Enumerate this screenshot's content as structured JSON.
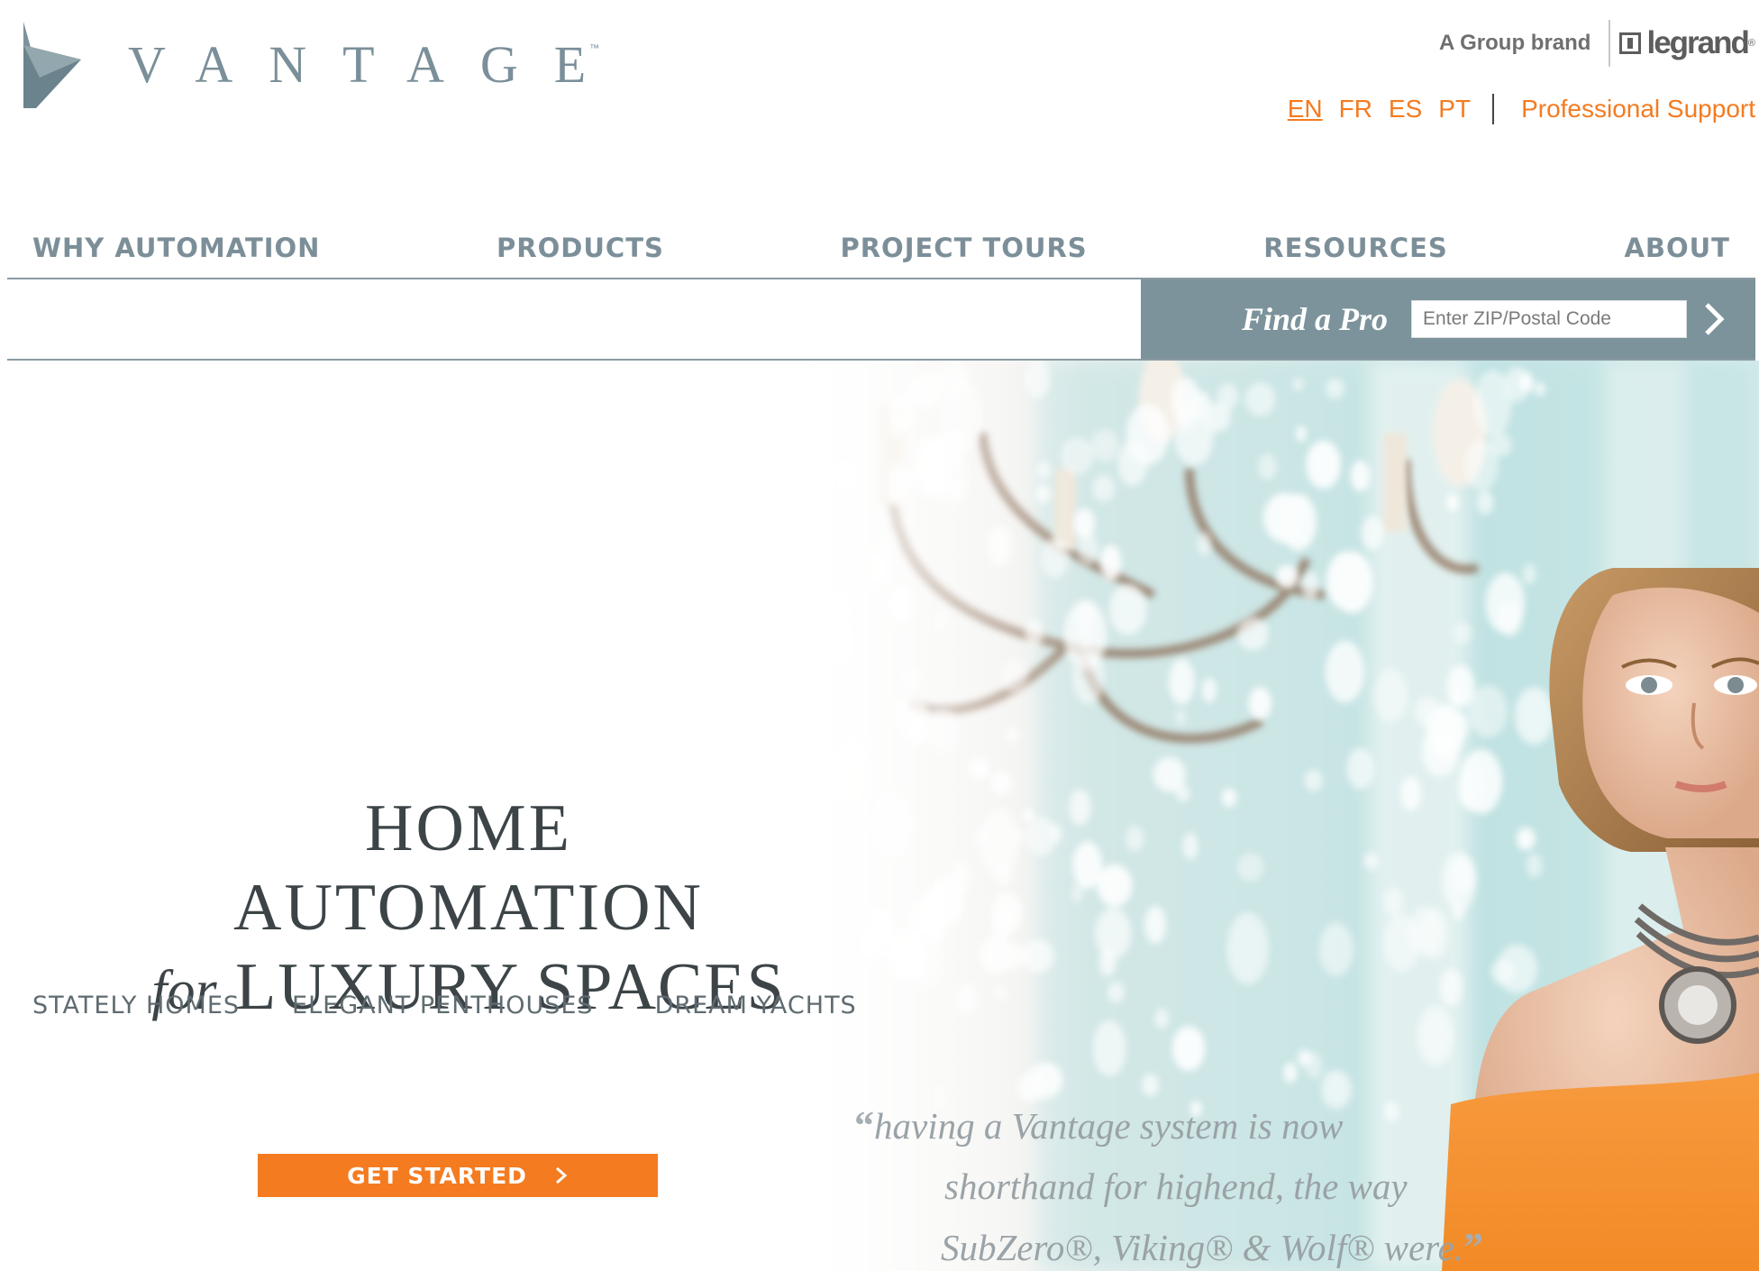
{
  "header": {
    "logo_text": "VANTAGE",
    "logo_tm": "™",
    "group_brand": "A Group brand",
    "partner_logo": "legrand",
    "partner_logo_mark": "®"
  },
  "utility_nav": {
    "languages": [
      "EN",
      "FR",
      "ES",
      "PT"
    ],
    "active_language": "EN",
    "professional_support": "Professional Support"
  },
  "main_nav": {
    "items": [
      "WHY AUTOMATION",
      "PRODUCTS",
      "PROJECT TOURS",
      "RESOURCES",
      "ABOUT"
    ]
  },
  "find_pro": {
    "label": "Find a Pro",
    "placeholder": "Enter ZIP/Postal Code",
    "go_icon": "chevron-right-icon"
  },
  "hero": {
    "headline_line1": "HOME AUTOMATION",
    "headline_line2_italic": "for",
    "headline_line2_rest": "LUXURY SPACES",
    "segments": [
      "STATELY HOMES",
      "ELEGANT PENTHOUSES",
      "DREAM YACHTS"
    ],
    "cta_label": "GET STARTED",
    "quote_open": "“",
    "quote_line1": "having a Vantage system is now",
    "quote_line2": "shorthand for highend, the way",
    "quote_line3": "SubZero®, Viking® & Wolf® were.",
    "quote_close": "”"
  },
  "colors": {
    "accent": "#f47b20",
    "brand_slate": "#7c939b",
    "nav_text": "#7c8f99",
    "headline": "#3c4447"
  }
}
